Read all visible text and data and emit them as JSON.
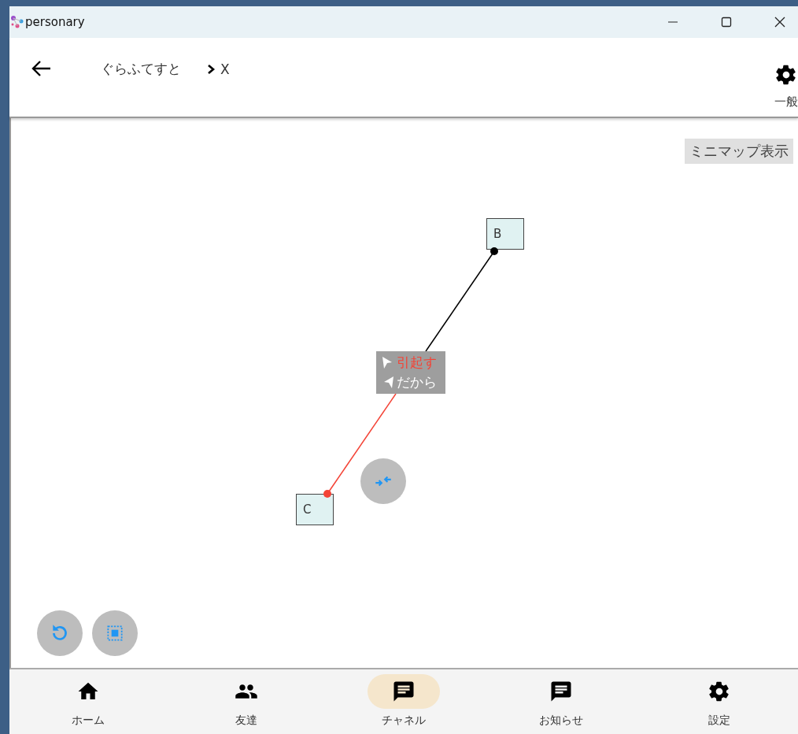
{
  "window": {
    "title": "personary"
  },
  "header": {
    "breadcrumb": [
      "ぐらふてすと",
      "X"
    ],
    "settings_label": "一般"
  },
  "canvas": {
    "minimap_button": "ミニマップ表示",
    "nodes": [
      {
        "label": "B"
      },
      {
        "label": "C"
      }
    ],
    "edges": [
      {
        "color": "#000000"
      },
      {
        "color": "#f44336"
      }
    ],
    "relations": [
      {
        "label": "引起す",
        "color": "#f44336"
      },
      {
        "label": "だから",
        "color": "#ffffff"
      }
    ]
  },
  "nav": [
    {
      "label": "ホーム",
      "selected": false
    },
    {
      "label": "友達",
      "selected": false
    },
    {
      "label": "チャネル",
      "selected": true
    },
    {
      "label": "お知らせ",
      "selected": false
    },
    {
      "label": "設定",
      "selected": false
    }
  ]
}
